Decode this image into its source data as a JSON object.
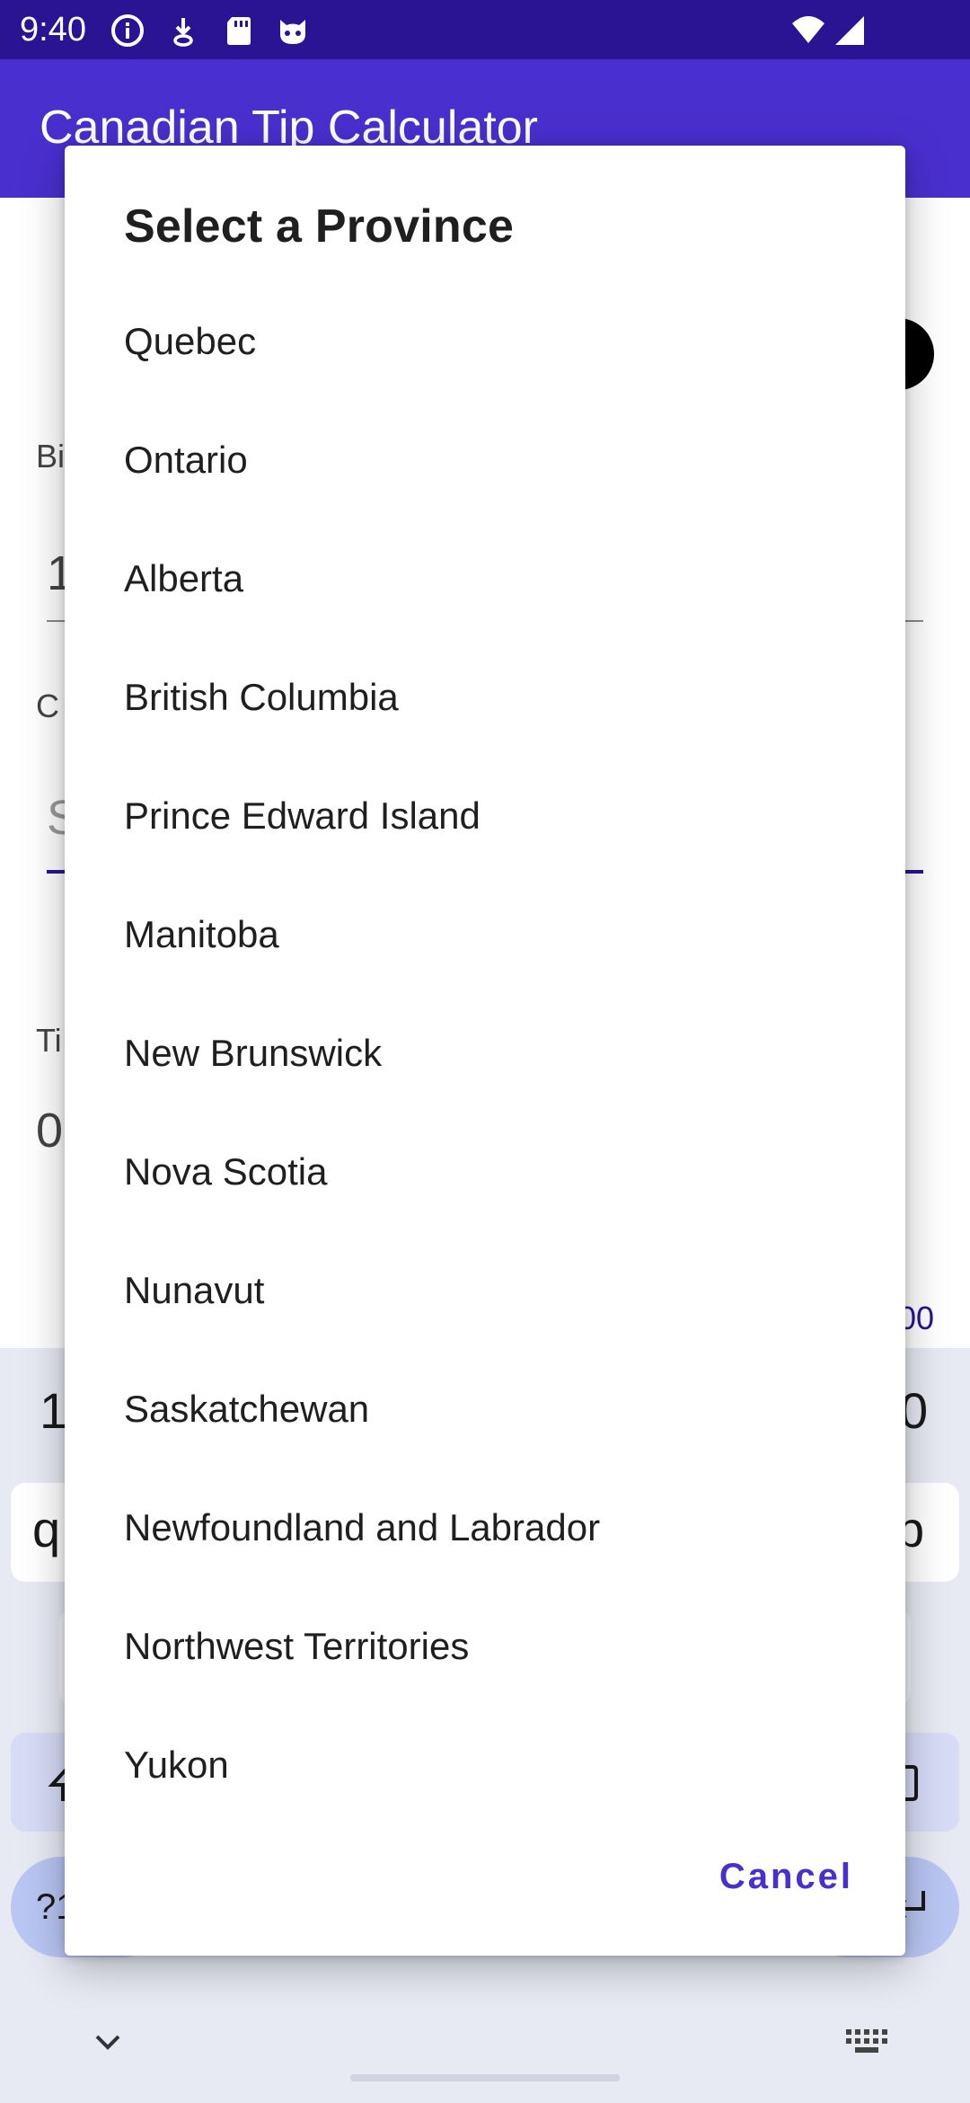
{
  "status_bar": {
    "time": "9:40",
    "icons": [
      "info-icon",
      "download-notification-icon",
      "sd-card-icon",
      "cat-face-icon",
      "wifi-icon",
      "cellular-signal-icon"
    ]
  },
  "app": {
    "title": "Canadian Tip Calculator",
    "colors": {
      "status_bar": "#2a1493",
      "app_bar": "#4a2fcf",
      "accent": "#4a2fcf"
    }
  },
  "background": {
    "partial_labels": [
      "Bi",
      "1",
      "C",
      "S",
      "Ti",
      "0",
      "00",
      "1",
      "q",
      "p",
      "0",
      "?1"
    ]
  },
  "dialog": {
    "title": "Select a Province",
    "provinces": [
      "Quebec",
      "Ontario",
      "Alberta",
      "British Columbia",
      "Prince Edward Island",
      "Manitoba",
      "New Brunswick",
      "Nova Scotia",
      "Nunavut",
      "Saskatchewan",
      "Newfoundland and Labrador",
      "Northwest Territories",
      "Yukon"
    ],
    "cancel_label": "Cancel"
  },
  "keyboard": {
    "icons": [
      "shift-icon",
      "backspace-icon",
      "enter-icon",
      "chevron-down-icon",
      "keyboard-icon"
    ]
  }
}
